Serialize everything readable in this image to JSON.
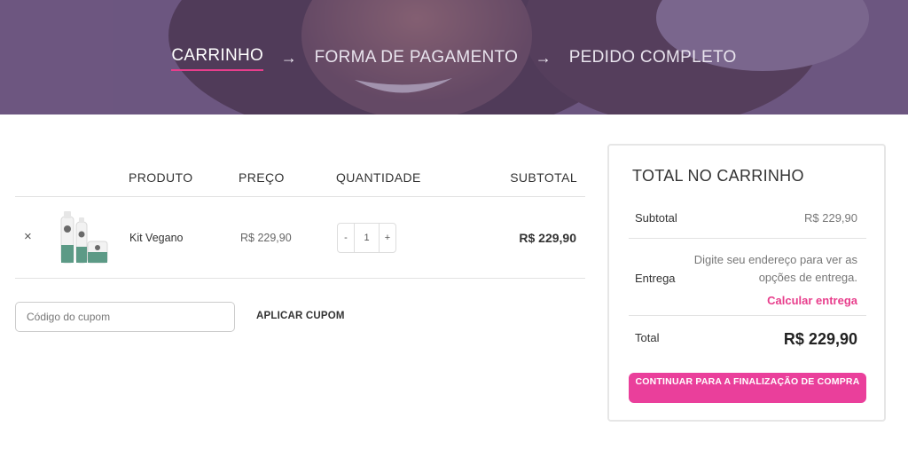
{
  "checkout_steps": {
    "step1": "CARRINHO",
    "step2": "FORMA DE PAGAMENTO",
    "step3": "PEDIDO COMPLETO",
    "arrow": "→"
  },
  "cart_table": {
    "headers": {
      "product": "PRODUTO",
      "price": "PREÇO",
      "quantity": "QUANTIDADE",
      "subtotal": "SUBTOTAL"
    },
    "items": [
      {
        "remove": "×",
        "name": "Kit Vegano",
        "price": "R$ 229,90",
        "qty_minus": "-",
        "quantity": "1",
        "qty_plus": "+",
        "subtotal": "R$ 229,90"
      }
    ]
  },
  "coupon": {
    "placeholder": "Código do cupom",
    "apply_label": "APLICAR CUPOM"
  },
  "totals": {
    "title": "TOTAL NO CARRINHO",
    "subtotal_label": "Subtotal",
    "subtotal_value": "R$ 229,90",
    "shipping_label": "Entrega",
    "shipping_note": "Digite seu endereço para ver as opções de entrega.",
    "shipping_link": "Calcular entrega",
    "total_label": "Total",
    "total_value": "R$ 229,90",
    "checkout_button": "CONTINUAR PARA A FINALIZAÇÃO DE COMPRA"
  },
  "colors": {
    "accent": "#ea3f9b",
    "step_underline": "#e83e8c",
    "banner_overlay": "#6f5a7e"
  }
}
